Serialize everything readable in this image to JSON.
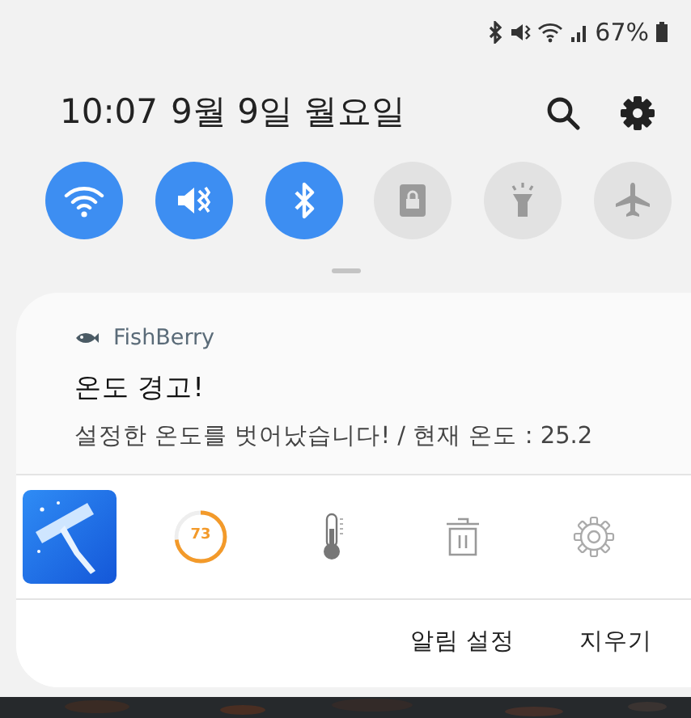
{
  "status_bar": {
    "battery_text": "67%"
  },
  "header": {
    "clock": "10:07",
    "date": "9월 9일 월요일"
  },
  "quick_toggles": [
    {
      "kind": "wifi",
      "on": true
    },
    {
      "kind": "vibrate",
      "on": true
    },
    {
      "kind": "bluetooth",
      "on": true
    },
    {
      "kind": "screen-lock",
      "on": false
    },
    {
      "kind": "flashlight",
      "on": false
    },
    {
      "kind": "airplane",
      "on": false
    }
  ],
  "notification": {
    "app_name": "FishBerry",
    "title": "온도 경고!",
    "body": "설정한 온도를 벗어났습니다! / 현재 온도 : 25.2"
  },
  "shortcuts": [
    {
      "kind": "app"
    },
    {
      "kind": "gauge",
      "text": "73",
      "level": 0.73
    },
    {
      "kind": "thermometer"
    },
    {
      "kind": "trash"
    },
    {
      "kind": "settings"
    }
  ],
  "actions": [
    "알림 설정",
    "지우기"
  ]
}
